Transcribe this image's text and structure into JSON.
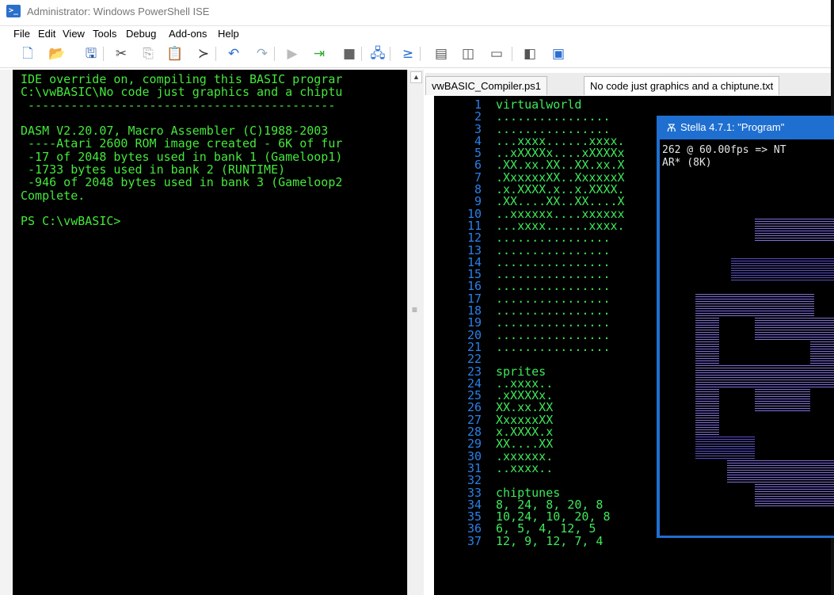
{
  "window": {
    "title": "Administrator: Windows PowerShell ISE",
    "icon": "powershell-icon"
  },
  "menu": [
    "File",
    "Edit",
    "View",
    "Tools",
    "Debug",
    "Add-ons",
    "Help"
  ],
  "toolbar": [
    {
      "name": "new-script-icon",
      "glyph": "🗋",
      "color": "#4b7fc8"
    },
    {
      "name": "open-icon",
      "glyph": "📂",
      "color": "#d8a021"
    },
    {
      "name": "save-icon",
      "glyph": "🖫",
      "color": "#2a5aa8"
    },
    {
      "name": "cut-icon",
      "glyph": "✂",
      "color": "#444"
    },
    {
      "name": "copy-icon",
      "glyph": "⎘",
      "color": "#aaa"
    },
    {
      "name": "paste-icon",
      "glyph": "📋",
      "color": "#333"
    },
    {
      "name": "clear-console-icon",
      "glyph": "≻",
      "color": "#333"
    },
    {
      "name": "undo-icon",
      "glyph": "↶",
      "color": "#2a6fd1"
    },
    {
      "name": "redo-icon",
      "glyph": "↷",
      "color": "#9ab"
    },
    {
      "name": "run-script-icon",
      "glyph": "▶",
      "color": "#bbb"
    },
    {
      "name": "run-selection-icon",
      "glyph": "⇥",
      "color": "#3a3"
    },
    {
      "name": "stop-icon",
      "glyph": "■",
      "color": "#666"
    },
    {
      "name": "remote-powershell-icon",
      "glyph": "🖧",
      "color": "#2a6fd1"
    },
    {
      "name": "start-powershell-icon",
      "glyph": "≥",
      "color": "#2a6fd1"
    },
    {
      "name": "layout-top-icon",
      "glyph": "▤",
      "color": "#555"
    },
    {
      "name": "layout-right-icon",
      "glyph": "◫",
      "color": "#555"
    },
    {
      "name": "layout-max-icon",
      "glyph": "▭",
      "color": "#555"
    },
    {
      "name": "show-script-pane-icon",
      "glyph": "◧",
      "color": "#555"
    },
    {
      "name": "show-commands-icon",
      "glyph": "▣",
      "color": "#2a6fd1"
    }
  ],
  "console": {
    "lines": [
      "IDE override on, compiling this BASIC prograr",
      "C:\\vwBASIC\\No code just graphics and a chiptu",
      " -------------------------------------------",
      "",
      "DASM V2.20.07, Macro Assembler (C)1988-2003",
      " ----Atari 2600 ROM image created - 6K of fur",
      " -17 of 2048 bytes used in bank 1 (Gameloop1)",
      " -1733 bytes used in bank 2 (RUNTIME)",
      " -946 of 2048 bytes used in bank 3 (Gameloop2",
      "Complete.",
      "",
      "PS C:\\vwBASIC>"
    ]
  },
  "tabs": [
    "vwBASIC_Compiler.ps1",
    "No code just graphics and a chiptune.txt"
  ],
  "editor": {
    "line_numbers": [
      "1",
      "2",
      "3",
      "4",
      "5",
      "6",
      "7",
      "8",
      "9",
      "10",
      "11",
      "12",
      "13",
      "14",
      "15",
      "16",
      "17",
      "18",
      "19",
      "20",
      "21",
      "22",
      "23",
      "24",
      "25",
      "26",
      "27",
      "28",
      "29",
      "30",
      "31",
      "32",
      "33",
      "34",
      "35",
      "36",
      "37"
    ],
    "lines": [
      "virtualworld",
      "................",
      "................",
      "...xxxx......xxxx.",
      "..xXXXXx....xXXXXx",
      ".XX.xx.XX..XX.xx.X",
      ".XxxxxxXX..XxxxxxX",
      ".x.XXXX.x..x.XXXX.",
      ".XX....XX..XX....X",
      "..xxxxxx....xxxxxx",
      "...xxxx......xxxx.",
      "................",
      "................",
      "................",
      "................",
      "................",
      "................",
      "................",
      "................",
      "................",
      "................",
      "",
      "sprites",
      "..xxxx..",
      ".xXXXXx.",
      "XX.xx.XX",
      "XxxxxxXX",
      "x.XXXX.x",
      "XX....XX",
      ".xxxxxx.",
      "..xxxx..",
      "",
      "chiptunes",
      "8, 24, 8, 20, 8",
      "10,24, 10, 20, 8",
      "6, 5, 4, 12, 5",
      "12, 9, 12, 7, 4"
    ]
  },
  "stella": {
    "title": "Stella 4.7.1: \"Program\"",
    "info_line1": "262 @ 60.00fps => NT",
    "info_line2": "AR* (8K)"
  },
  "colors": {
    "console_text": "#44e83a",
    "line_numbers": "#2a80e8",
    "code_text": "#3ee85a",
    "stella_frame": "#1f6fd1",
    "sprite": "#7f6ed8"
  }
}
